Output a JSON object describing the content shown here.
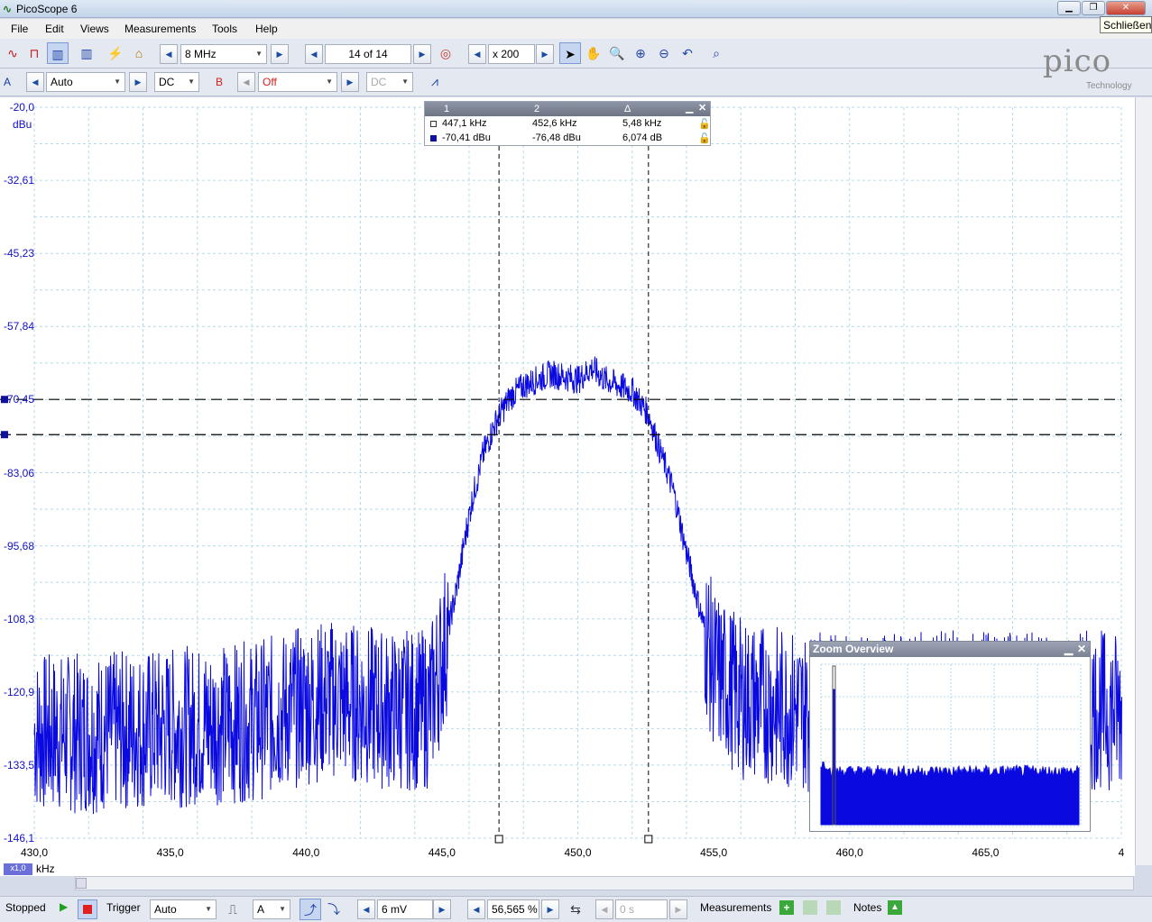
{
  "window": {
    "title": "PicoScope 6",
    "close_tooltip": "Schließen"
  },
  "menu": [
    "File",
    "Edit",
    "Views",
    "Measurements",
    "Tools",
    "Help"
  ],
  "toolbar1": {
    "sample_rate": "8 MHz",
    "buffer": "14 of 14",
    "zoom": "x 200"
  },
  "toolbar2": {
    "channel_a": "A",
    "range_a": "Auto",
    "coupling_a": "DC",
    "channel_b": "B",
    "range_b": "Off",
    "coupling_b": "DC"
  },
  "logo": {
    "brand": "pico",
    "sub": "Technology"
  },
  "axes": {
    "y_ticks": [
      "-20,0",
      "-32,61",
      "-45,23",
      "-57,84",
      "-70,45",
      "-83,06",
      "-95,68",
      "-108,3",
      "-120,9",
      "-133,5",
      "-146,1"
    ],
    "y_unit": "dBu",
    "x_ticks": [
      "430,0",
      "435,0",
      "440,0",
      "445,0",
      "450,0",
      "455,0",
      "460,0",
      "465,0",
      "4"
    ],
    "x_unit": "kHz",
    "x_scale": "x1,0"
  },
  "measurement_table": {
    "col1": "1",
    "col2": "2",
    "col3": "Δ",
    "rows": [
      [
        "447,1 kHz",
        "452,6 kHz",
        "5,48 kHz"
      ],
      [
        "-70,41 dBu",
        "-76,48 dBu",
        "6,074 dB"
      ]
    ]
  },
  "zoom_overview": {
    "title": "Zoom Overview"
  },
  "status": {
    "state": "Stopped",
    "trigger_label": "Trigger",
    "trigger_mode": "Auto",
    "trigger_channel": "A",
    "threshold": "6 mV",
    "pretrigger": "56,565 %",
    "delay": "0 s",
    "measurements": "Measurements",
    "notes": "Notes"
  },
  "chart_data": {
    "type": "line",
    "title": "",
    "xlabel": "kHz",
    "ylabel": "dBu",
    "xlim": [
      430.0,
      470.0
    ],
    "ylim": [
      -146.1,
      -20.0
    ],
    "series": [
      {
        "x": [
          430,
          432,
          435,
          438,
          440,
          441,
          443,
          444.5,
          445,
          445.5,
          446,
          446.5,
          447,
          447.5,
          448,
          449,
          450,
          450.5,
          451,
          452,
          452.6,
          453,
          453.5,
          454,
          454.5,
          455,
          456,
          458,
          460,
          465,
          468
        ],
        "y": [
          -128,
          -128,
          -127,
          -126,
          -123,
          -122,
          -124,
          -124,
          -115,
          -104,
          -90,
          -80,
          -74,
          -70,
          -68,
          -66,
          -67,
          -65,
          -67,
          -69,
          -73,
          -79,
          -86,
          -97,
          -107,
          -117,
          -122,
          -124,
          -125,
          -124,
          -124
        ]
      }
    ],
    "cursors": {
      "x": [
        447.1,
        452.6
      ],
      "y": [
        -70.41,
        -76.48
      ]
    }
  }
}
